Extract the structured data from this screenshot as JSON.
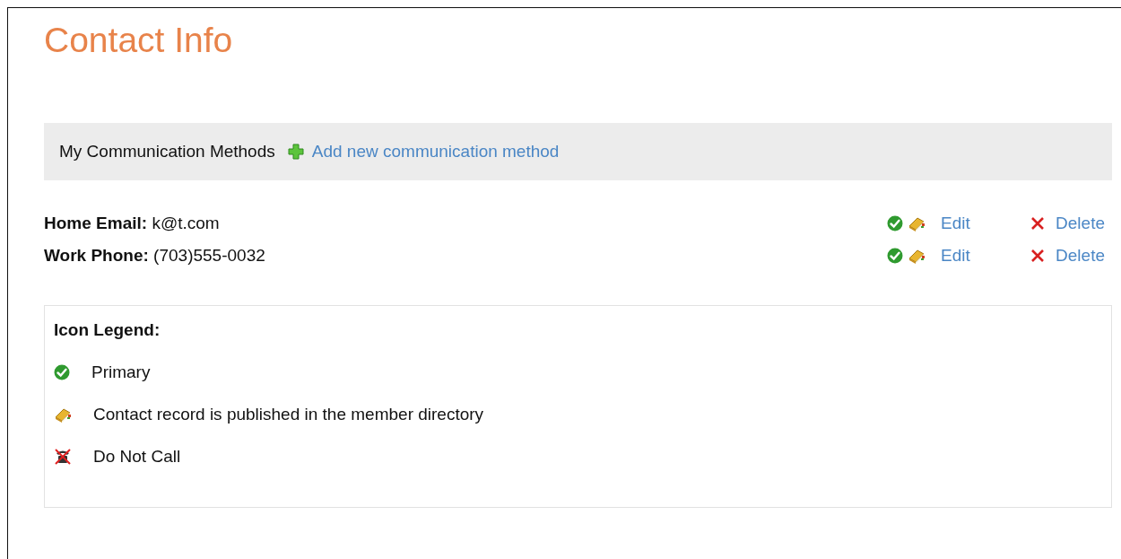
{
  "title": "Contact Info",
  "toolbar": {
    "label": "My Communication Methods",
    "add_link": "Add new communication method"
  },
  "methods": [
    {
      "label": "Home Email:",
      "value": "k@t.com",
      "primary": true,
      "published": true,
      "edit": "Edit",
      "delete": "Delete"
    },
    {
      "label": "Work Phone:",
      "value": "(703)555-0032",
      "primary": true,
      "published": true,
      "edit": "Edit",
      "delete": "Delete"
    }
  ],
  "legend": {
    "title": "Icon Legend:",
    "items": [
      {
        "kind": "primary",
        "text": "Primary"
      },
      {
        "kind": "published",
        "text": "Contact record is published in the member directory"
      },
      {
        "kind": "do-not-call",
        "text": "Do Not Call"
      }
    ]
  }
}
